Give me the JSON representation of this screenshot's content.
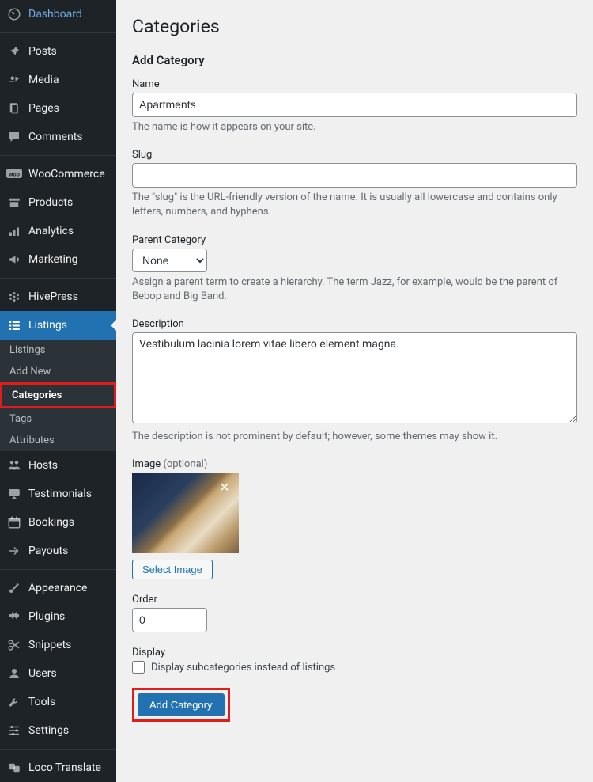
{
  "sidebar": {
    "items": [
      {
        "label": "Dashboard",
        "icon": "dashboard"
      },
      {
        "label": "Posts",
        "icon": "pin"
      },
      {
        "label": "Media",
        "icon": "media"
      },
      {
        "label": "Pages",
        "icon": "page"
      },
      {
        "label": "Comments",
        "icon": "comment"
      },
      {
        "label": "WooCommerce",
        "icon": "woo"
      },
      {
        "label": "Products",
        "icon": "archive"
      },
      {
        "label": "Analytics",
        "icon": "analytics"
      },
      {
        "label": "Marketing",
        "icon": "megaphone"
      },
      {
        "label": "HivePress",
        "icon": "hivepress"
      },
      {
        "label": "Listings",
        "icon": "listings",
        "active": true
      },
      {
        "label": "Hosts",
        "icon": "hosts"
      },
      {
        "label": "Testimonials",
        "icon": "testimonial"
      },
      {
        "label": "Bookings",
        "icon": "calendar"
      },
      {
        "label": "Payouts",
        "icon": "payout"
      },
      {
        "label": "Appearance",
        "icon": "brush"
      },
      {
        "label": "Plugins",
        "icon": "plugin"
      },
      {
        "label": "Snippets",
        "icon": "scissors"
      },
      {
        "label": "Users",
        "icon": "users"
      },
      {
        "label": "Tools",
        "icon": "wrench"
      },
      {
        "label": "Settings",
        "icon": "sliders"
      },
      {
        "label": "Loco Translate",
        "icon": "loco"
      }
    ],
    "submenu": [
      {
        "label": "Listings"
      },
      {
        "label": "Add New"
      },
      {
        "label": "Categories",
        "current": true
      },
      {
        "label": "Tags"
      },
      {
        "label": "Attributes"
      }
    ]
  },
  "page": {
    "title": "Categories",
    "section_title": "Add Category"
  },
  "form": {
    "name": {
      "label": "Name",
      "value": "Apartments",
      "help": "The name is how it appears on your site."
    },
    "slug": {
      "label": "Slug",
      "value": "",
      "help": "The \"slug\" is the URL-friendly version of the name. It is usually all lowercase and contains only letters, numbers, and hyphens."
    },
    "parent": {
      "label": "Parent Category",
      "value": "None",
      "help": "Assign a parent term to create a hierarchy. The term Jazz, for example, would be the parent of Bebop and Big Band."
    },
    "description": {
      "label": "Description",
      "value": "Vestibulum lacinia lorem vitae libero element magna.",
      "help": "The description is not prominent by default; however, some themes may show it."
    },
    "image": {
      "label": "Image",
      "optional": "(optional)",
      "select_btn": "Select Image"
    },
    "order": {
      "label": "Order",
      "value": "0"
    },
    "display": {
      "label": "Display",
      "checkbox_label": "Display subcategories instead of listings"
    },
    "submit_btn": "Add Category"
  }
}
